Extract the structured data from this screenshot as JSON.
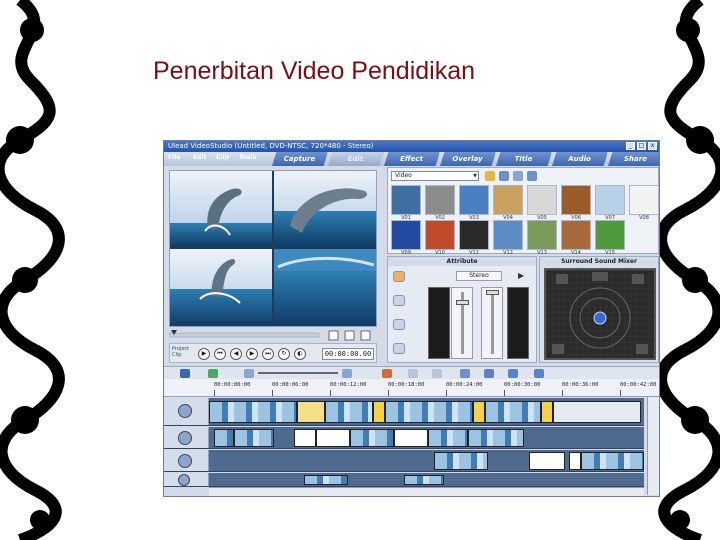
{
  "slide": {
    "title": "Penerbitan Video Pendidikan"
  },
  "window": {
    "title": "Ulead VideoStudio (Untitled, DVD-NTSC, 720*480 - Stereo)"
  },
  "menu": [
    "File",
    "Edit",
    "Clip",
    "Tools"
  ],
  "steps": [
    "Capture",
    "Edit",
    "Effect",
    "Overlay",
    "Title",
    "Audio",
    "Share"
  ],
  "active_step": "Edit",
  "library": {
    "category": "Video",
    "thumbs": [
      {
        "label": "V01",
        "color": "#3f6ea3"
      },
      {
        "label": "V02",
        "color": "#8c8c8c"
      },
      {
        "label": "V03",
        "color": "#4a7fc1"
      },
      {
        "label": "V04",
        "color": "#c9a060"
      },
      {
        "label": "V05",
        "color": "#d8d8d8"
      },
      {
        "label": "V06",
        "color": "#9b5a2a"
      },
      {
        "label": "V07",
        "color": "#b8d0e8"
      },
      {
        "label": "V08",
        "color": "#f2f2f2"
      },
      {
        "label": "V09",
        "color": "#224aa0"
      },
      {
        "label": "V10",
        "color": "#c14a2a"
      },
      {
        "label": "V11",
        "color": "#2a2a2a"
      },
      {
        "label": "V12",
        "color": "#5f8bc4"
      },
      {
        "label": "V13",
        "color": "#7a9a5a"
      },
      {
        "label": "V14",
        "color": "#a86a3a"
      },
      {
        "label": "V15",
        "color": "#4f9a3a"
      }
    ]
  },
  "attribute": {
    "tab": "Attribute",
    "channel": "Stereo"
  },
  "mixer": {
    "title": "Surround Sound Mixer"
  },
  "player": {
    "label_project": "Project",
    "label_clip": "Clip",
    "timecode": "00:00:00.00"
  },
  "timeline": {
    "ruler": [
      "00:00:00:00",
      "00:00:06:00",
      "00:00:12:00",
      "00:00:18:00",
      "00:00:24:00",
      "00:00:30:00",
      "00:00:36:00",
      "00:00:42:00"
    ]
  }
}
